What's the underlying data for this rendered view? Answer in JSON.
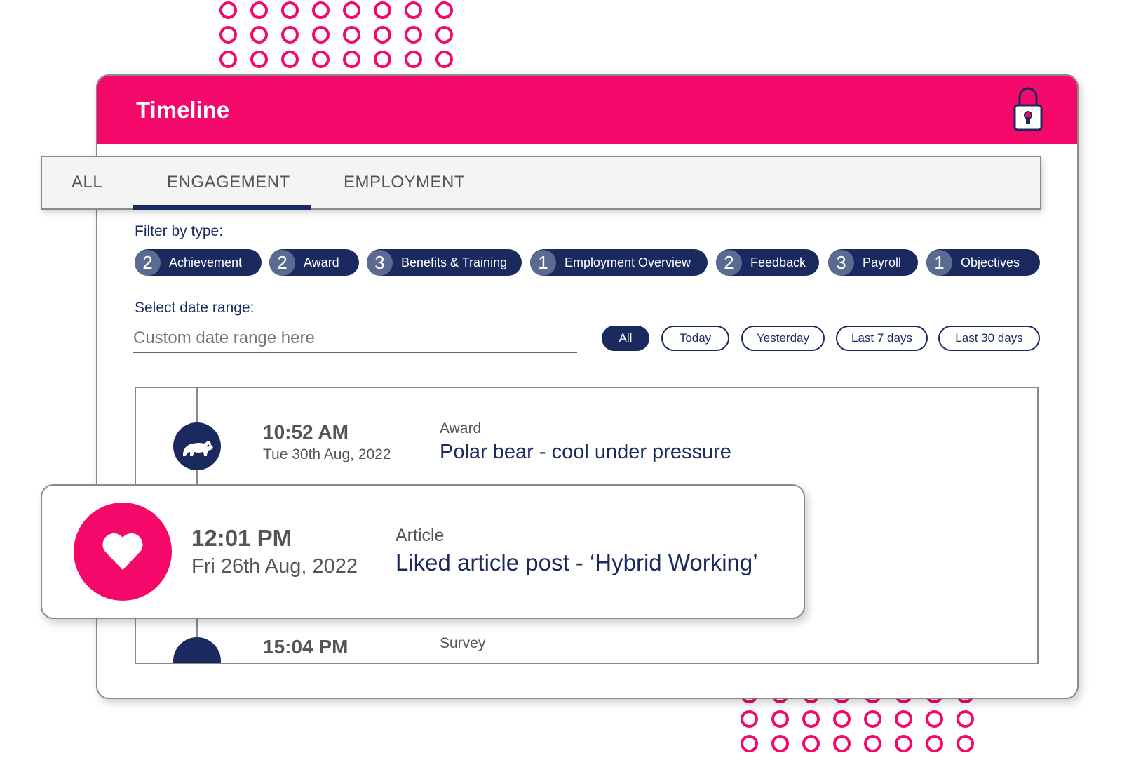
{
  "window": {
    "title": "Timeline"
  },
  "tabs": [
    {
      "label": "ALL"
    },
    {
      "label": "ENGAGEMENT",
      "active": true
    },
    {
      "label": "EMPLOYMENT"
    }
  ],
  "filter": {
    "label": "Filter by type:",
    "chips": [
      {
        "count": "2",
        "label": "Achievement"
      },
      {
        "count": "2",
        "label": "Award"
      },
      {
        "count": "3",
        "label": "Benefits & Training"
      },
      {
        "count": "1",
        "label": "Employment Overview"
      },
      {
        "count": "2",
        "label": "Feedback"
      },
      {
        "count": "3",
        "label": "Payroll"
      },
      {
        "count": "1",
        "label": "Objectives"
      }
    ]
  },
  "date_range": {
    "label": "Select date range:",
    "placeholder": "Custom date range here",
    "options": [
      "All",
      "Today",
      "Yesterday",
      "Last 7 days",
      "Last 30 days"
    ],
    "selected": "All"
  },
  "events": [
    {
      "time": "10:52 AM",
      "date": "Tue 30th Aug, 2022",
      "type": "Award",
      "title": "Polar bear - cool under pressure",
      "icon": "polar-bear-icon"
    },
    {
      "time": "15:04 PM",
      "type": "Survey"
    }
  ],
  "highlight": {
    "time": "12:01 PM",
    "date": "Fri 26th Aug, 2022",
    "type": "Article",
    "title": "Liked article post - ‘Hybrid Working’",
    "icon": "heart-icon"
  },
  "colors": {
    "brand_pink": "#f4086a",
    "navy": "#1b2a5e",
    "chip_count_bg": "#5b6a90"
  }
}
